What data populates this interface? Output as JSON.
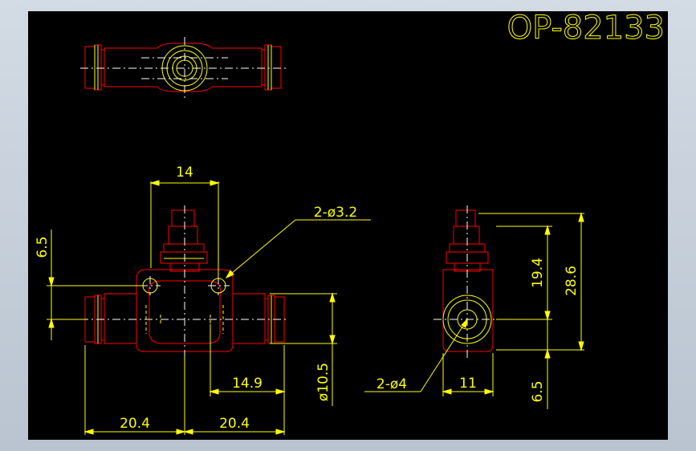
{
  "drawing": {
    "title": "OP-82133",
    "background_color": "#000000",
    "frame_color": "#c9d2dc",
    "outline_color": "#ff0000",
    "dimension_color": "#ffff00",
    "centerline_color": "#ffffff",
    "dimensions": {
      "top_width": "14",
      "left_offset": "6.5",
      "hole_callout": "2-ø3.2",
      "port_callout": "2-ø4",
      "half_len_left": "20.4",
      "half_len_right": "20.4",
      "port_offset": "14.9",
      "port_dia": "ø10.5",
      "side_width": "11",
      "height_inner": "19.4",
      "height_total": "28.6",
      "bottom_offset": "6.5"
    }
  }
}
